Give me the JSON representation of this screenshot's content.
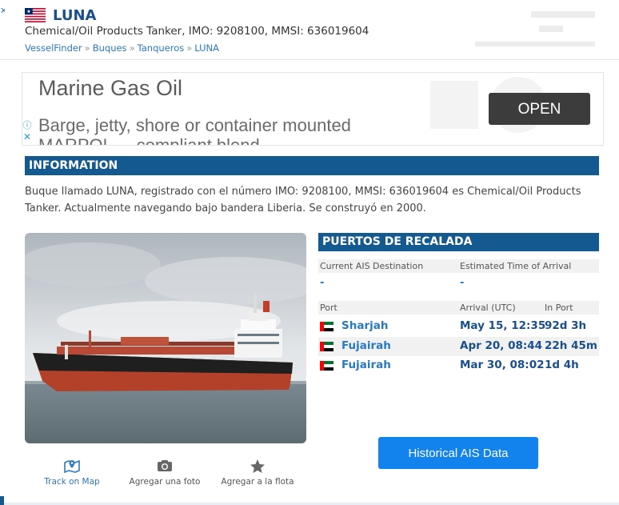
{
  "header": {
    "vessel_name": "LUNA",
    "subtitle": "Chemical/Oil Products Tanker, IMO: 9208100, MMSI: 636019604",
    "flag_icon": "liberia-flag-icon",
    "breadcrumb": [
      "VesselFinder",
      "Buques",
      "Tanqueros",
      "LUNA"
    ],
    "breadcrumb_sep": "»"
  },
  "ad": {
    "title": "Marine Gas Oil",
    "subtitle": "Barge, jetty, shore or container mounted",
    "subtitle2": "MARPOL ... compliant blend",
    "open_label": "OPEN",
    "info_icon": "info-icon",
    "close_icon": "close-icon"
  },
  "info": {
    "heading": "INFORMATION",
    "text": "Buque llamado LUNA, registrado con el número IMO: 9208100, MMSI: 636019604 es Chemical/Oil Products Tanker. Actualmente navegando bajo bandera Liberia. Se construyó en 2000."
  },
  "actions": {
    "track_label": "Track on Map",
    "photo_label": "Agregar una foto",
    "fleet_label": "Agregar a la flota"
  },
  "ports": {
    "heading": "PUERTOS DE RECALADA",
    "dest_header": "Current AIS Destination",
    "eta_header": "Estimated Time of Arrival",
    "dest_value": "-",
    "eta_value": "-",
    "port_header": "Port",
    "arrival_header": "Arrival (UTC)",
    "inport_header": "In Port",
    "rows": [
      {
        "port": "Sharjah",
        "arrival": "May 15, 12:35",
        "in_port": "92d 3h",
        "flag_icon": "uae-flag-icon"
      },
      {
        "port": "Fujairah",
        "arrival": "Apr 20, 08:44",
        "in_port": "22h 45m",
        "flag_icon": "uae-flag-icon"
      },
      {
        "port": "Fujairah",
        "arrival": "Mar 30, 08:02",
        "in_port": "1d 4h",
        "flag_icon": "uae-flag-icon"
      }
    ]
  },
  "historical_button": "Historical AIS Data",
  "colors": {
    "header_bar": "#14598f",
    "link": "#2a7ac0",
    "button": "#1283ec",
    "ad_button": "#3c3c3c"
  }
}
